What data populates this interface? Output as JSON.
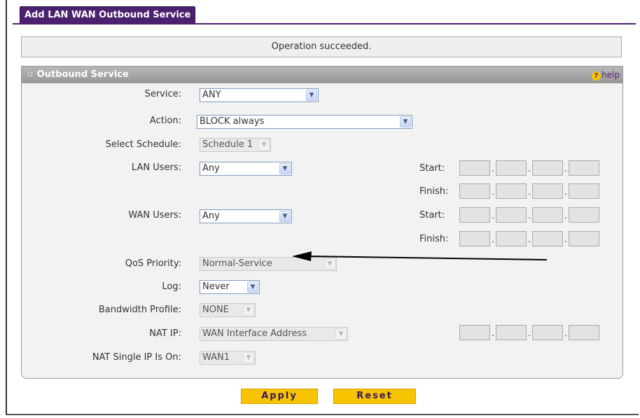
{
  "tab": {
    "title": "Add LAN WAN Outbound Service"
  },
  "status": {
    "message": "Operation succeeded."
  },
  "panel": {
    "title": "Outbound Service",
    "help": "help"
  },
  "form": {
    "service": {
      "label": "Service:",
      "value": "ANY"
    },
    "action": {
      "label": "Action:",
      "value": "BLOCK always"
    },
    "schedule": {
      "label": "Select Schedule:",
      "value": "Schedule 1"
    },
    "lan_users": {
      "label": "LAN Users:",
      "value": "Any"
    },
    "wan_users": {
      "label": "WAN Users:",
      "value": "Any"
    },
    "qos": {
      "label": "QoS Priority:",
      "value": "Normal-Service"
    },
    "log": {
      "label": "Log:",
      "value": "Never"
    },
    "bandwidth": {
      "label": "Bandwidth Profile:",
      "value": "NONE"
    },
    "nat_ip": {
      "label": "NAT IP:",
      "value": "WAN Interface Address"
    },
    "nat_single": {
      "label": "NAT Single IP Is On:",
      "value": "WAN1"
    },
    "start_label": "Start:",
    "finish_label": "Finish:"
  },
  "buttons": {
    "apply": "Apply",
    "reset": "Reset"
  }
}
